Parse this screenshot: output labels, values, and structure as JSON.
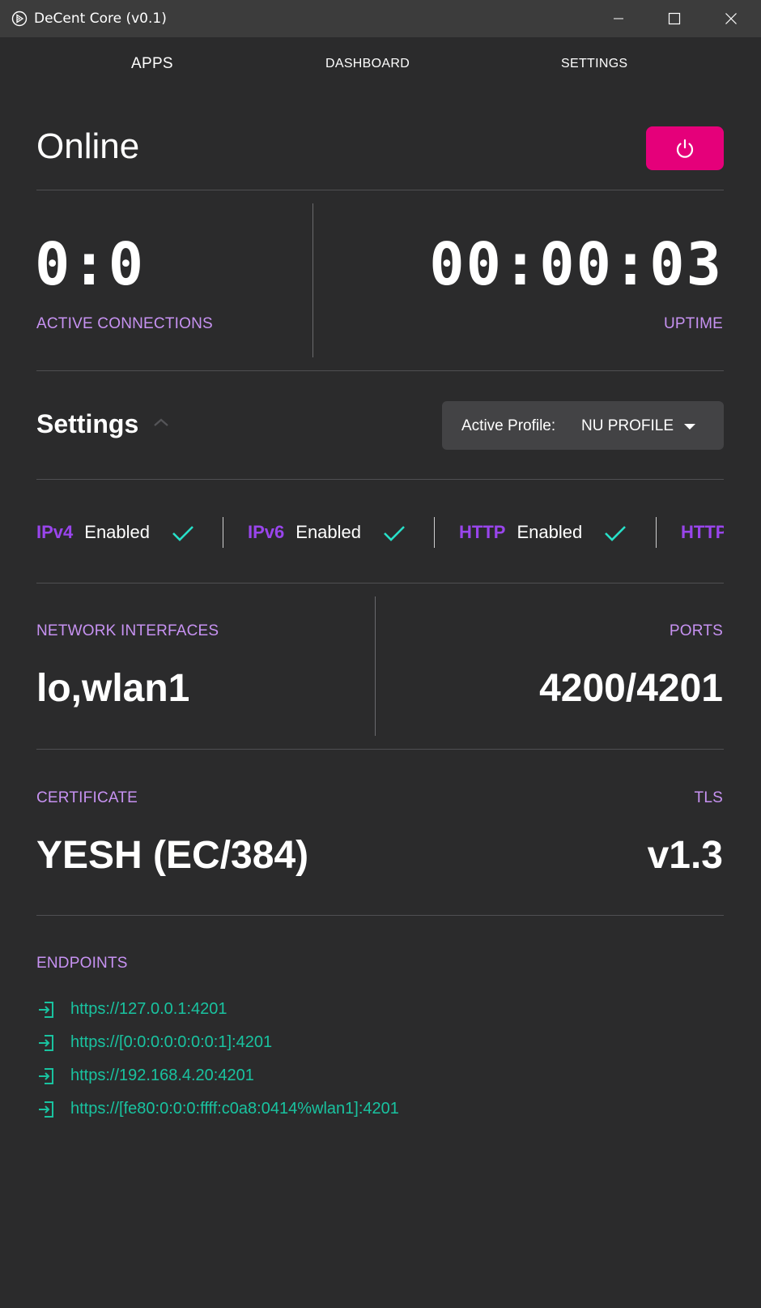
{
  "window": {
    "title": "DeCent Core (v0.1)"
  },
  "nav": {
    "apps": "APPS",
    "dashboard": "DASHBOARD",
    "settings": "SETTINGS"
  },
  "status": {
    "title": "Online"
  },
  "stats": {
    "connections_value": "0:0",
    "connections_label": "ACTIVE CONNECTIONS",
    "uptime_value": "00:00:03",
    "uptime_label": "UPTIME"
  },
  "settings": {
    "title": "Settings",
    "profile_label": "Active Profile:",
    "profile_value": "NU PROFILE"
  },
  "protocols": [
    {
      "name": "IPv4",
      "state": "Enabled"
    },
    {
      "name": "IPv6",
      "state": "Enabled"
    },
    {
      "name": "HTTP",
      "state": "Enabled"
    },
    {
      "name": "HTTPS",
      "state": ""
    }
  ],
  "network": {
    "interfaces_label": "NETWORK INTERFACES",
    "interfaces_value": "lo,wlan1",
    "ports_label": "PORTS",
    "ports_value": "4200/4201"
  },
  "security": {
    "certificate_label": "CERTIFICATE",
    "certificate_value": "YESH (EC/384)",
    "tls_label": "TLS",
    "tls_value": "v1.3"
  },
  "endpoints": {
    "label": "ENDPOINTS",
    "items": [
      "https://127.0.0.1:4201",
      "https://[0:0:0:0:0:0:0:1]:4201",
      "https://192.168.4.20:4201",
      "https://[fe80:0:0:0:ffff:c0a8:0414%wlan1]:4201"
    ]
  },
  "colors": {
    "background": "#2b2b2c",
    "accent_label": "#c792f2",
    "protocol_name": "#9945ec",
    "power_button": "#e5007a",
    "endpoint": "#19c3a0",
    "check": "#27e0c8"
  },
  "icons": {
    "app": "app-logo-icon",
    "minimize": "minimize-icon",
    "maximize": "maximize-icon",
    "close": "close-icon",
    "power": "power-icon",
    "collapse": "chevron-up-icon",
    "dropdown": "caret-down-icon",
    "check": "check-icon",
    "endpoint": "login-arrow-icon"
  }
}
